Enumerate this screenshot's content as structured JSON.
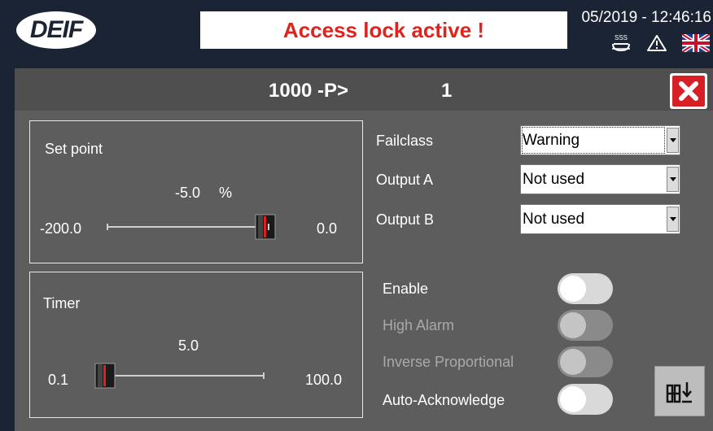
{
  "header": {
    "logo_text": "DEIF",
    "lock_banner": "Access lock active !",
    "datetime": "05/2019 - 12:46:16",
    "icons": [
      "heater-icon",
      "warning-icon",
      "uk-flag-icon"
    ],
    "heater_glyph": "SSS"
  },
  "panel": {
    "title_code": "1000 -P>",
    "title_number": "1",
    "close_icon": "close-icon",
    "accent_color": "#d91f26"
  },
  "setpoint": {
    "label": "Set point",
    "value": "-5.0",
    "unit": "%",
    "min_label": "-200.0",
    "max_label": "0.0",
    "position_fraction": 0.975
  },
  "timer": {
    "label": "Timer",
    "value": "5.0",
    "min_label": "0.1",
    "max_label": "100.0",
    "position_fraction": 0.049
  },
  "settings": {
    "failclass": {
      "label": "Failclass",
      "value": "Warning"
    },
    "output_a": {
      "label": "Output A",
      "value": "Not used"
    },
    "output_b": {
      "label": "Output B",
      "value": "Not used"
    }
  },
  "toggles": [
    {
      "label": "Enable",
      "state": "on",
      "enabled": true
    },
    {
      "label": "High Alarm",
      "state": "off",
      "enabled": false
    },
    {
      "label": "Inverse Proportional",
      "state": "off",
      "enabled": false
    },
    {
      "label": "Auto-Acknowledge",
      "state": "on",
      "enabled": true
    }
  ],
  "save_icon": "save-to-device-icon"
}
